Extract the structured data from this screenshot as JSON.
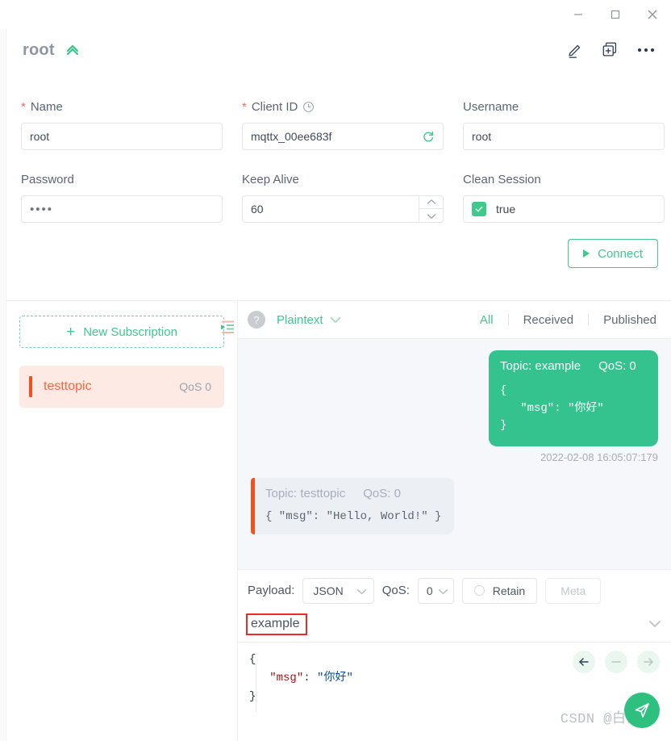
{
  "window": {
    "minimize_label": "Minimize",
    "maximize_label": "Maximize",
    "close_label": "Close"
  },
  "connection": {
    "title": "root",
    "collapse_icon": "double-chevron-up-icon",
    "actions": {
      "edit_label": "Edit",
      "duplicate_label": "New window",
      "more_label": "More"
    }
  },
  "form": {
    "name": {
      "label": "Name",
      "required_mark": "*",
      "value": "root"
    },
    "client_id": {
      "label": "Client ID",
      "required_mark": "*",
      "value": "mqttx_00ee683f",
      "refresh_icon": "refresh-icon",
      "history_icon": "clock-icon"
    },
    "username": {
      "label": "Username",
      "value": "root"
    },
    "password": {
      "label": "Password",
      "value": "••••"
    },
    "keep_alive": {
      "label": "Keep Alive",
      "value": "60"
    },
    "clean_session": {
      "label": "Clean Session",
      "value": "true",
      "checked": true
    },
    "connect_button": "Connect"
  },
  "subscriptions": {
    "new_subscription_label": "New Subscription",
    "plus_icon": "plus-icon",
    "collapse_icon": "collapse-panel-icon",
    "items": [
      {
        "topic": "testtopic",
        "qos": "QoS 0"
      }
    ]
  },
  "messages_toolbar": {
    "help_icon": "question-icon",
    "format": "Plaintext",
    "format_chevron": "chevron-down-icon",
    "tabs": [
      {
        "label": "All",
        "active": true
      },
      {
        "label": "Received",
        "active": false
      },
      {
        "label": "Published",
        "active": false
      }
    ]
  },
  "messages": [
    {
      "direction": "published",
      "topic_label": "Topic: example",
      "qos_label": "QoS: 0",
      "body": "{\n   \"msg\": \"你好\"\n}",
      "time": "2022-02-08 16:05:07:179"
    },
    {
      "direction": "received",
      "topic_label": "Topic: testtopic",
      "qos_label": "QoS: 0",
      "body": "{ \"msg\": \"Hello, World!\" }",
      "time": ""
    }
  ],
  "publish_bar": {
    "payload_label": "Payload:",
    "payload_format": "JSON",
    "qos_label": "QoS:",
    "qos_value": "0",
    "retain_label": "Retain",
    "retain_checked": false,
    "meta_label": "Meta",
    "topic_value": "example",
    "topic_chevron": "chevron-down-icon"
  },
  "editor": {
    "line1": "{",
    "line2_key": "\"msg\"",
    "line2_sep": ": ",
    "line2_val": "\"你好\"",
    "line3": "}",
    "actions": {
      "back_icon": "arrow-left-icon",
      "minus_icon": "arrow-minus-icon",
      "forward_icon": "arrow-right-icon",
      "send_icon": "send-icon"
    }
  },
  "watermark": "CSDN @白茶",
  "colors": {
    "accent_green": "#3fc98c",
    "bubble_green": "#34c38f",
    "accent_orange": "#f4501e",
    "sub_bg": "#fdeae4",
    "annotation_red": "#ef2a20",
    "text_muted": "#9aa3ae"
  }
}
